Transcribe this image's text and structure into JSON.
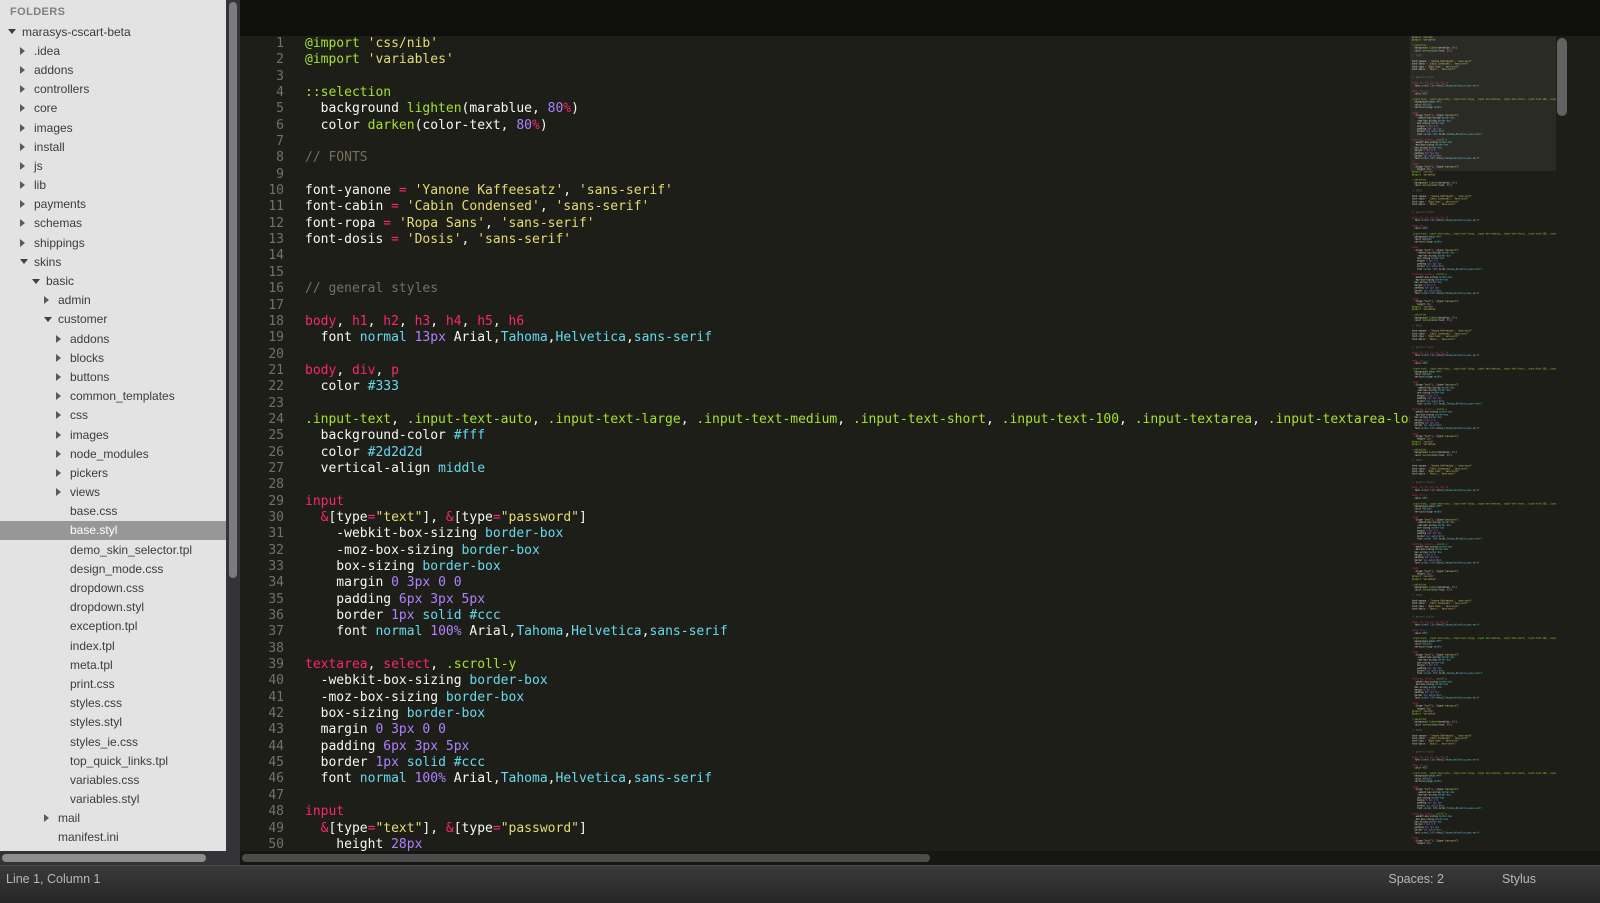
{
  "colors": {
    "p": "#f92672",
    "g": "#a6e22e",
    "y": "#e6db74",
    "c": "#66d9ef",
    "v": "#ae81ff",
    "w": "#f8f8f2",
    "m": "#75715e"
  },
  "sidebar": {
    "header": "FOLDERS",
    "items": [
      {
        "label": "marasys-cscart-beta",
        "depth": 0,
        "type": "folder",
        "expanded": true
      },
      {
        "label": ".idea",
        "depth": 1,
        "type": "folder",
        "expanded": false
      },
      {
        "label": "addons",
        "depth": 1,
        "type": "folder",
        "expanded": false
      },
      {
        "label": "controllers",
        "depth": 1,
        "type": "folder",
        "expanded": false
      },
      {
        "label": "core",
        "depth": 1,
        "type": "folder",
        "expanded": false
      },
      {
        "label": "images",
        "depth": 1,
        "type": "folder",
        "expanded": false
      },
      {
        "label": "install",
        "depth": 1,
        "type": "folder",
        "expanded": false
      },
      {
        "label": "js",
        "depth": 1,
        "type": "folder",
        "expanded": false
      },
      {
        "label": "lib",
        "depth": 1,
        "type": "folder",
        "expanded": false
      },
      {
        "label": "payments",
        "depth": 1,
        "type": "folder",
        "expanded": false
      },
      {
        "label": "schemas",
        "depth": 1,
        "type": "folder",
        "expanded": false
      },
      {
        "label": "shippings",
        "depth": 1,
        "type": "folder",
        "expanded": false
      },
      {
        "label": "skins",
        "depth": 1,
        "type": "folder",
        "expanded": true
      },
      {
        "label": "basic",
        "depth": 2,
        "type": "folder",
        "expanded": true
      },
      {
        "label": "admin",
        "depth": 3,
        "type": "folder",
        "expanded": false
      },
      {
        "label": "customer",
        "depth": 3,
        "type": "folder",
        "expanded": true
      },
      {
        "label": "addons",
        "depth": 4,
        "type": "folder",
        "expanded": false
      },
      {
        "label": "blocks",
        "depth": 4,
        "type": "folder",
        "expanded": false
      },
      {
        "label": "buttons",
        "depth": 4,
        "type": "folder",
        "expanded": false
      },
      {
        "label": "common_templates",
        "depth": 4,
        "type": "folder",
        "expanded": false
      },
      {
        "label": "css",
        "depth": 4,
        "type": "folder",
        "expanded": false
      },
      {
        "label": "images",
        "depth": 4,
        "type": "folder",
        "expanded": false
      },
      {
        "label": "node_modules",
        "depth": 4,
        "type": "folder",
        "expanded": false
      },
      {
        "label": "pickers",
        "depth": 4,
        "type": "folder",
        "expanded": false
      },
      {
        "label": "views",
        "depth": 4,
        "type": "folder",
        "expanded": false
      },
      {
        "label": "base.css",
        "depth": 4,
        "type": "file"
      },
      {
        "label": "base.styl",
        "depth": 4,
        "type": "file",
        "selected": true
      },
      {
        "label": "demo_skin_selector.tpl",
        "depth": 4,
        "type": "file"
      },
      {
        "label": "design_mode.css",
        "depth": 4,
        "type": "file"
      },
      {
        "label": "dropdown.css",
        "depth": 4,
        "type": "file"
      },
      {
        "label": "dropdown.styl",
        "depth": 4,
        "type": "file"
      },
      {
        "label": "exception.tpl",
        "depth": 4,
        "type": "file"
      },
      {
        "label": "index.tpl",
        "depth": 4,
        "type": "file"
      },
      {
        "label": "meta.tpl",
        "depth": 4,
        "type": "file"
      },
      {
        "label": "print.css",
        "depth": 4,
        "type": "file"
      },
      {
        "label": "styles.css",
        "depth": 4,
        "type": "file"
      },
      {
        "label": "styles.styl",
        "depth": 4,
        "type": "file"
      },
      {
        "label": "styles_ie.css",
        "depth": 4,
        "type": "file"
      },
      {
        "label": "top_quick_links.tpl",
        "depth": 4,
        "type": "file"
      },
      {
        "label": "variables.css",
        "depth": 4,
        "type": "file"
      },
      {
        "label": "variables.styl",
        "depth": 4,
        "type": "file"
      },
      {
        "label": "mail",
        "depth": 3,
        "type": "folder",
        "expanded": false
      },
      {
        "label": "manifest.ini",
        "depth": 3,
        "type": "file"
      }
    ]
  },
  "editor": {
    "lines": [
      {
        "tokens": [
          [
            "g",
            "@import"
          ],
          [
            "w",
            " "
          ],
          [
            "y",
            "'css/nib'"
          ]
        ]
      },
      {
        "tokens": [
          [
            "g",
            "@import"
          ],
          [
            "w",
            " "
          ],
          [
            "y",
            "'variables'"
          ]
        ]
      },
      {
        "tokens": []
      },
      {
        "tokens": [
          [
            "g",
            "::selection"
          ]
        ]
      },
      {
        "tokens": [
          [
            "w",
            "  background "
          ],
          [
            "g",
            "lighten"
          ],
          [
            "w",
            "(marablue, "
          ],
          [
            "v",
            "80"
          ],
          [
            "p",
            "%"
          ],
          [
            "w",
            ")"
          ]
        ]
      },
      {
        "tokens": [
          [
            "w",
            "  color "
          ],
          [
            "g",
            "darken"
          ],
          [
            "w",
            "(color-text, "
          ],
          [
            "v",
            "80"
          ],
          [
            "p",
            "%"
          ],
          [
            "w",
            ")"
          ]
        ]
      },
      {
        "tokens": []
      },
      {
        "tokens": [
          [
            "m",
            "// FONTS"
          ]
        ]
      },
      {
        "tokens": []
      },
      {
        "tokens": [
          [
            "w",
            "font-yanone "
          ],
          [
            "p",
            "="
          ],
          [
            "w",
            " "
          ],
          [
            "y",
            "'Yanone Kaffeesatz'"
          ],
          [
            "w",
            ", "
          ],
          [
            "y",
            "'sans-serif'"
          ]
        ]
      },
      {
        "tokens": [
          [
            "w",
            "font-cabin "
          ],
          [
            "p",
            "="
          ],
          [
            "w",
            " "
          ],
          [
            "y",
            "'Cabin Condensed'"
          ],
          [
            "w",
            ", "
          ],
          [
            "y",
            "'sans-serif'"
          ]
        ]
      },
      {
        "tokens": [
          [
            "w",
            "font-ropa "
          ],
          [
            "p",
            "="
          ],
          [
            "w",
            " "
          ],
          [
            "y",
            "'Ropa Sans'"
          ],
          [
            "w",
            ", "
          ],
          [
            "y",
            "'sans-serif'"
          ]
        ]
      },
      {
        "tokens": [
          [
            "w",
            "font-dosis "
          ],
          [
            "p",
            "="
          ],
          [
            "w",
            " "
          ],
          [
            "y",
            "'Dosis'"
          ],
          [
            "w",
            ", "
          ],
          [
            "y",
            "'sans-serif'"
          ]
        ]
      },
      {
        "tokens": []
      },
      {
        "tokens": []
      },
      {
        "tokens": [
          [
            "m",
            "// general styles"
          ]
        ]
      },
      {
        "tokens": []
      },
      {
        "tokens": [
          [
            "p",
            "body"
          ],
          [
            "w",
            ", "
          ],
          [
            "p",
            "h1"
          ],
          [
            "w",
            ", "
          ],
          [
            "p",
            "h2"
          ],
          [
            "w",
            ", "
          ],
          [
            "p",
            "h3"
          ],
          [
            "w",
            ", "
          ],
          [
            "p",
            "h4"
          ],
          [
            "w",
            ", "
          ],
          [
            "p",
            "h5"
          ],
          [
            "w",
            ", "
          ],
          [
            "p",
            "h6"
          ]
        ]
      },
      {
        "tokens": [
          [
            "w",
            "  font "
          ],
          [
            "c",
            "normal"
          ],
          [
            "w",
            " "
          ],
          [
            "v",
            "13px"
          ],
          [
            "w",
            " Arial,"
          ],
          [
            "c",
            "Tahoma"
          ],
          [
            "w",
            ","
          ],
          [
            "c",
            "Helvetica"
          ],
          [
            "w",
            ","
          ],
          [
            "c",
            "sans-serif"
          ]
        ]
      },
      {
        "tokens": []
      },
      {
        "tokens": [
          [
            "p",
            "body"
          ],
          [
            "w",
            ", "
          ],
          [
            "p",
            "div"
          ],
          [
            "w",
            ", "
          ],
          [
            "p",
            "p"
          ]
        ]
      },
      {
        "tokens": [
          [
            "w",
            "  color "
          ],
          [
            "c",
            "#333"
          ]
        ]
      },
      {
        "tokens": []
      },
      {
        "tokens": [
          [
            "g",
            ".input-text"
          ],
          [
            "w",
            ", "
          ],
          [
            "g",
            ".input-text-auto"
          ],
          [
            "w",
            ", "
          ],
          [
            "g",
            ".input-text-large"
          ],
          [
            "w",
            ", "
          ],
          [
            "g",
            ".input-text-medium"
          ],
          [
            "w",
            ", "
          ],
          [
            "g",
            ".input-text-short"
          ],
          [
            "w",
            ", "
          ],
          [
            "g",
            ".input-text-100"
          ],
          [
            "w",
            ", "
          ],
          [
            "g",
            ".input-textarea"
          ],
          [
            "w",
            ", "
          ],
          [
            "g",
            ".input-textarea-long"
          ],
          [
            "w",
            ","
          ]
        ]
      },
      {
        "tokens": [
          [
            "w",
            "  background-color "
          ],
          [
            "c",
            "#fff"
          ]
        ]
      },
      {
        "tokens": [
          [
            "w",
            "  color "
          ],
          [
            "c",
            "#2d2d2d"
          ]
        ]
      },
      {
        "tokens": [
          [
            "w",
            "  vertical-align "
          ],
          [
            "c",
            "middle"
          ]
        ]
      },
      {
        "tokens": []
      },
      {
        "tokens": [
          [
            "p",
            "input"
          ]
        ]
      },
      {
        "tokens": [
          [
            "w",
            "  "
          ],
          [
            "p",
            "&"
          ],
          [
            "w",
            "[type"
          ],
          [
            "p",
            "="
          ],
          [
            "y",
            "\"text\""
          ],
          [
            "w",
            "], "
          ],
          [
            "p",
            "&"
          ],
          [
            "w",
            "[type"
          ],
          [
            "p",
            "="
          ],
          [
            "y",
            "\"password\""
          ],
          [
            "w",
            "]"
          ]
        ]
      },
      {
        "tokens": [
          [
            "w",
            "    -webkit-box-sizing "
          ],
          [
            "c",
            "border-box"
          ]
        ]
      },
      {
        "tokens": [
          [
            "w",
            "    -moz-box-sizing "
          ],
          [
            "c",
            "border-box"
          ]
        ]
      },
      {
        "tokens": [
          [
            "w",
            "    box-sizing "
          ],
          [
            "c",
            "border-box"
          ]
        ]
      },
      {
        "tokens": [
          [
            "w",
            "    margin "
          ],
          [
            "v",
            "0"
          ],
          [
            "w",
            " "
          ],
          [
            "v",
            "3px"
          ],
          [
            "w",
            " "
          ],
          [
            "v",
            "0"
          ],
          [
            "w",
            " "
          ],
          [
            "v",
            "0"
          ]
        ]
      },
      {
        "tokens": [
          [
            "w",
            "    padding "
          ],
          [
            "v",
            "6px"
          ],
          [
            "w",
            " "
          ],
          [
            "v",
            "3px"
          ],
          [
            "w",
            " "
          ],
          [
            "v",
            "5px"
          ]
        ]
      },
      {
        "tokens": [
          [
            "w",
            "    border "
          ],
          [
            "v",
            "1px"
          ],
          [
            "w",
            " "
          ],
          [
            "c",
            "solid"
          ],
          [
            "w",
            " "
          ],
          [
            "c",
            "#ccc"
          ]
        ]
      },
      {
        "tokens": [
          [
            "w",
            "    font "
          ],
          [
            "c",
            "normal"
          ],
          [
            "w",
            " "
          ],
          [
            "v",
            "100%"
          ],
          [
            "w",
            " Arial,"
          ],
          [
            "c",
            "Tahoma"
          ],
          [
            "w",
            ","
          ],
          [
            "c",
            "Helvetica"
          ],
          [
            "w",
            ","
          ],
          [
            "c",
            "sans-serif"
          ]
        ]
      },
      {
        "tokens": []
      },
      {
        "tokens": [
          [
            "p",
            "textarea"
          ],
          [
            "w",
            ", "
          ],
          [
            "p",
            "select"
          ],
          [
            "w",
            ", "
          ],
          [
            "g",
            ".scroll-y"
          ]
        ]
      },
      {
        "tokens": [
          [
            "w",
            "  -webkit-box-sizing "
          ],
          [
            "c",
            "border-box"
          ]
        ]
      },
      {
        "tokens": [
          [
            "w",
            "  -moz-box-sizing "
          ],
          [
            "c",
            "border-box"
          ]
        ]
      },
      {
        "tokens": [
          [
            "w",
            "  box-sizing "
          ],
          [
            "c",
            "border-box"
          ]
        ]
      },
      {
        "tokens": [
          [
            "w",
            "  margin "
          ],
          [
            "v",
            "0"
          ],
          [
            "w",
            " "
          ],
          [
            "v",
            "3px"
          ],
          [
            "w",
            " "
          ],
          [
            "v",
            "0"
          ],
          [
            "w",
            " "
          ],
          [
            "v",
            "0"
          ]
        ]
      },
      {
        "tokens": [
          [
            "w",
            "  padding "
          ],
          [
            "v",
            "6px"
          ],
          [
            "w",
            " "
          ],
          [
            "v",
            "3px"
          ],
          [
            "w",
            " "
          ],
          [
            "v",
            "5px"
          ]
        ]
      },
      {
        "tokens": [
          [
            "w",
            "  border "
          ],
          [
            "v",
            "1px"
          ],
          [
            "w",
            " "
          ],
          [
            "c",
            "solid"
          ],
          [
            "w",
            " "
          ],
          [
            "c",
            "#ccc"
          ]
        ]
      },
      {
        "tokens": [
          [
            "w",
            "  font "
          ],
          [
            "c",
            "normal"
          ],
          [
            "w",
            " "
          ],
          [
            "v",
            "100%"
          ],
          [
            "w",
            " Arial,"
          ],
          [
            "c",
            "Tahoma"
          ],
          [
            "w",
            ","
          ],
          [
            "c",
            "Helvetica"
          ],
          [
            "w",
            ","
          ],
          [
            "c",
            "sans-serif"
          ]
        ]
      },
      {
        "tokens": []
      },
      {
        "tokens": [
          [
            "p",
            "input"
          ]
        ]
      },
      {
        "tokens": [
          [
            "w",
            "  "
          ],
          [
            "p",
            "&"
          ],
          [
            "w",
            "[type"
          ],
          [
            "p",
            "="
          ],
          [
            "y",
            "\"text\""
          ],
          [
            "w",
            "], "
          ],
          [
            "p",
            "&"
          ],
          [
            "w",
            "[type"
          ],
          [
            "p",
            "="
          ],
          [
            "y",
            "\"password\""
          ],
          [
            "w",
            "]"
          ]
        ]
      },
      {
        "tokens": [
          [
            "w",
            "    height "
          ],
          [
            "v",
            "28px"
          ]
        ]
      }
    ]
  },
  "status_bar": {
    "position": "Line 1, Column 1",
    "indent": "Spaces: 2",
    "syntax": "Stylus"
  }
}
